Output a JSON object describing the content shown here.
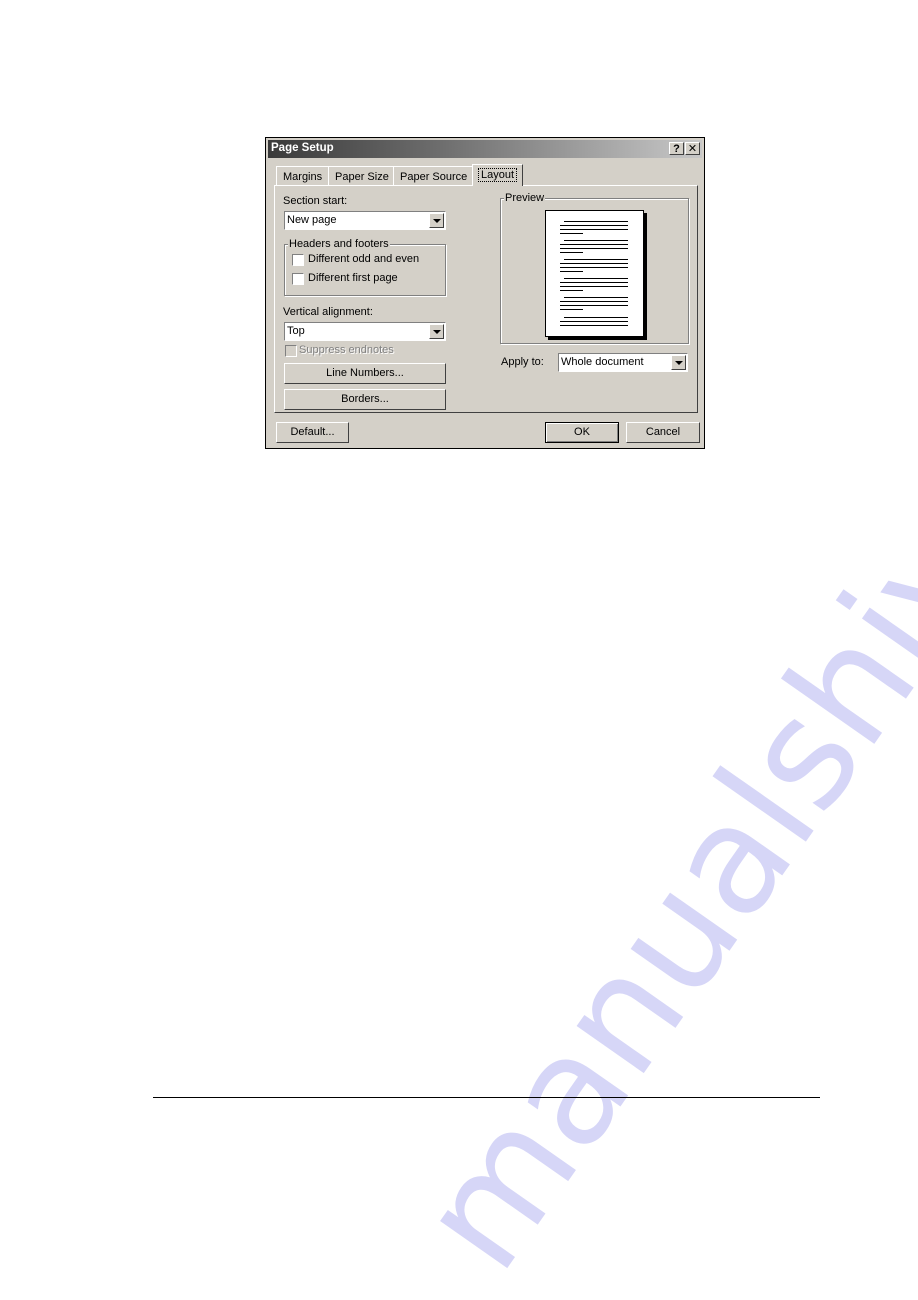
{
  "dialog": {
    "title": "Page Setup",
    "help_button": "?",
    "close_button": "✕",
    "tabs": [
      {
        "label": "Margins",
        "active": false
      },
      {
        "label": "Paper Size",
        "active": false
      },
      {
        "label": "Paper Source",
        "active": false
      },
      {
        "label": "Layout",
        "active": true
      }
    ],
    "layout": {
      "section_start_label": "Section start:",
      "section_start_value": "New page",
      "headers_footers_title": "Headers and footers",
      "checkbox_odd_even": {
        "label": "Different odd and even",
        "checked": false
      },
      "checkbox_first_page": {
        "label": "Different first page",
        "checked": false
      },
      "vertical_alignment_label": "Vertical alignment:",
      "vertical_alignment_value": "Top",
      "suppress_endnotes": {
        "label": "Suppress endnotes",
        "checked": false,
        "enabled": false
      },
      "line_numbers_button": "Line Numbers...",
      "borders_button": "Borders...",
      "preview_title": "Preview",
      "apply_to_label": "Apply to:",
      "apply_to_value": "Whole document"
    },
    "buttons": {
      "default": "Default...",
      "ok": "OK",
      "cancel": "Cancel"
    }
  },
  "watermark": "manualshive.com"
}
